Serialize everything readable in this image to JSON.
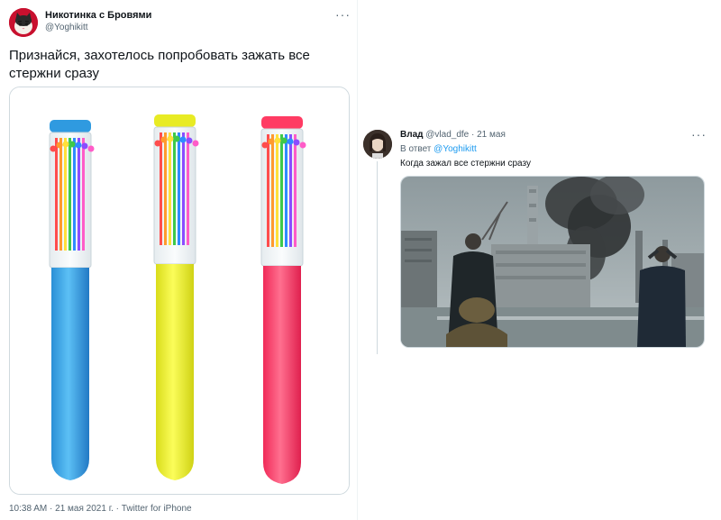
{
  "main_tweet": {
    "display_name": "Никотинка с Бровями",
    "handle": "@Yoghikitt",
    "more_label": "···",
    "text": "Признайся, захотелось попробовать зажать все стержни сразу",
    "meta": "10:38 AM · 21 мая 2021 г. · Twitter for iPhone"
  },
  "reply_tweet": {
    "display_name": "Влад",
    "handle": "@vlad_dfe",
    "time": "· 21 мая",
    "more_label": "···",
    "reply_to_prefix": "В ответ ",
    "reply_to_mention": "@Yoghikitt",
    "text": "Когда зажал все стержни сразу"
  },
  "colors": {
    "pen_blue": "#3aa6e8",
    "pen_yellow": "#eef02a",
    "pen_pink": "#ff3f6c",
    "accent": "#1d9bf0"
  }
}
